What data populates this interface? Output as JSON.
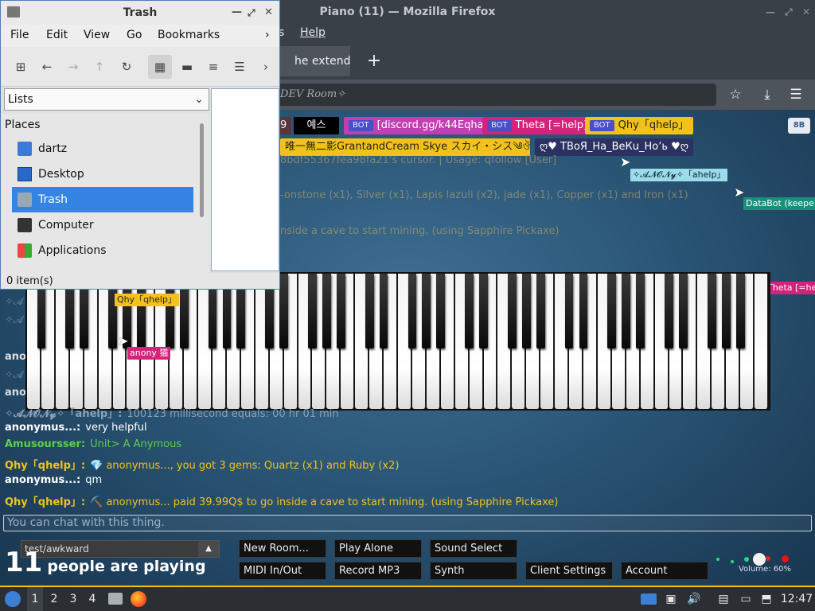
{
  "firefox": {
    "title": "Piano (11) — Mozilla Firefox",
    "menu_help": "Help",
    "menu_partial": "s",
    "tab_label": "he extende",
    "new_tab": "+",
    "url_text": "DEV Room✧"
  },
  "room_tags": [
    {
      "text": "9",
      "bot": false
    },
    {
      "text": "예스",
      "bot": false
    },
    {
      "text": "[discord.gg/k44Eqha]",
      "bot": true
    },
    {
      "text": "Theta [=help]",
      "bot": true
    },
    {
      "text": "Qhy「qhelp」",
      "bot": true
    },
    {
      "text": "唯一無二影GrantandCream Skye スカイ・シス༄ঔ",
      "bot": false
    },
    {
      "text": "ღ♥ ТВоЯ_На_ВеКu_Ноʼь ♥ღ",
      "bot": false
    }
  ],
  "bot_badge": "BOT",
  "translate_label": "8B",
  "floating": {
    "anon_tag": "✧𝓐𝓝𝓞𝓝𝔂✧「ahelp」",
    "databot": "DataBot (keepe",
    "theta": "Theta [=help",
    "qhy": "Qhy「qhelp」",
    "anony": "anony 猫"
  },
  "faint_lines": [
    "8bdf55367fea98fa21's cursor. | Usage: qfollow [User]",
    "-onstone (x1), Silver (x1), Lapis lazuli (x2), jade (x1), Copper (x1) and Iron (x1)",
    "nside a cave to start mining. (using Sapphire Pickaxe)"
  ],
  "left_fragments": [
    "✧𝓐",
    "✧𝓐",
    "ano",
    "✧𝓐",
    "ano"
  ],
  "chat": [
    {
      "name": "✧𝓐𝓝𝓞𝓝𝔂✧「ahelp」:",
      "text": "100123 millisecond equals: 00 hr 01 min",
      "name_color": "#8aa0b5",
      "text_color": "#8aa0b5"
    },
    {
      "name": "anonymus...:",
      "text": "very helpful",
      "name_color": "#ffffff",
      "text_color": "#ffffff"
    },
    {
      "name": "Amusoursser:",
      "text": "Unit> A Anymous",
      "name_color": "#5ad04a",
      "text_color": "#5ad04a"
    },
    {
      "name": "Qhy「qhelp」:",
      "text": "💎 anonymus..., you got 3 gems: Quartz (x1) and Ruby (x2)",
      "name_color": "#f2c21b",
      "text_color": "#f2c21b"
    },
    {
      "name": "anonymus...:",
      "text": "qm",
      "name_color": "#ffffff",
      "text_color": "#ffffff"
    },
    {
      "name": "Qhy「qhelp」:",
      "text": "⛏️ anonymus... paid 39.99Q$ to go inside a cave to start mining. (using Sapphire Pickaxe)",
      "name_color": "#f2c21b",
      "text_color": "#f2c21b"
    }
  ],
  "chat_placeholder": "You can chat with this thing.",
  "room_select": "test/awkward",
  "players": {
    "count": "11",
    "text": "people are playing"
  },
  "buttons": {
    "new_room": "New Room...",
    "play_alone": "Play Alone",
    "sound_select": "Sound Select",
    "midi": "MIDI In/Out",
    "record": "Record MP3",
    "synth": "Synth",
    "client_settings": "Client Settings",
    "account": "Account"
  },
  "volume": "Volume: 60%",
  "taskbar": {
    "workspaces": [
      "1",
      "2",
      "3",
      "4"
    ],
    "clock": "12:47"
  },
  "file_manager": {
    "title": "Trash",
    "menu": [
      "File",
      "Edit",
      "View",
      "Go",
      "Bookmarks"
    ],
    "dropdown": "Lists",
    "places_header": "Places",
    "places": [
      "dartz",
      "Desktop",
      "Trash",
      "Computer",
      "Applications"
    ],
    "status": "0 item(s)"
  },
  "colors": {
    "accent": "#3584e4",
    "taskbar_border": "#f0c400",
    "bot_badge": "#4b4fc7"
  }
}
